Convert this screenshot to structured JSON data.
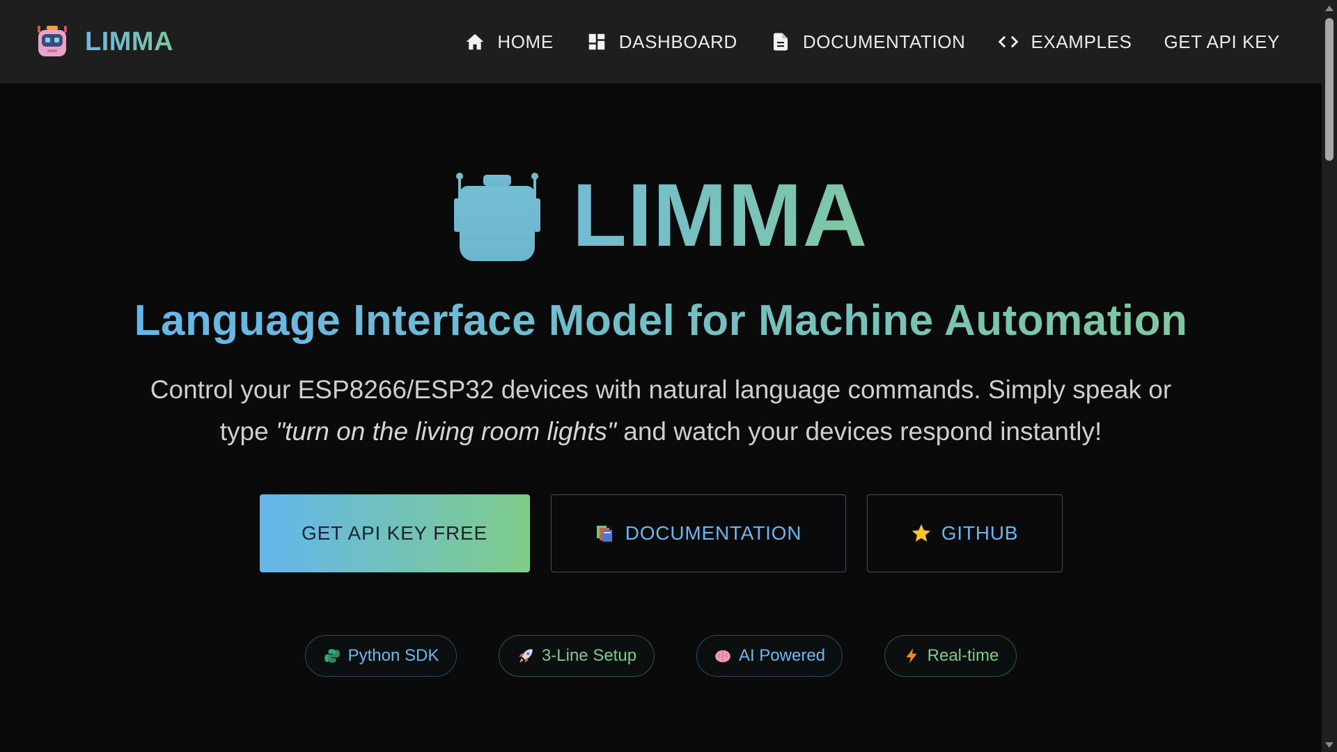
{
  "navbar": {
    "brand": "LIMMA",
    "links": [
      {
        "label": "HOME",
        "icon": "home-icon"
      },
      {
        "label": "DASHBOARD",
        "icon": "dashboard-icon"
      },
      {
        "label": "DOCUMENTATION",
        "icon": "document-icon"
      },
      {
        "label": "EXAMPLES",
        "icon": "code-icon"
      },
      {
        "label": "GET API KEY",
        "icon": ""
      }
    ]
  },
  "hero": {
    "title": "LIMMA",
    "tagline": "Language Interface Model for Machine Automation",
    "description_part1": "Control your ESP8266/ESP32 devices with natural language commands. Simply speak or type ",
    "description_quote": "\"turn on the living room lights\"",
    "description_part2": " and watch your devices respond instantly!"
  },
  "cta": {
    "primary": "GET API KEY FREE",
    "docs": "DOCUMENTATION",
    "github": "GITHUB"
  },
  "features": [
    {
      "label": "Python SDK",
      "icon": "python-icon"
    },
    {
      "label": "3-Line Setup",
      "icon": "rocket-icon"
    },
    {
      "label": "AI Powered",
      "icon": "brain-icon"
    },
    {
      "label": "Real-time",
      "icon": "lightning-icon"
    }
  ],
  "colors": {
    "background": "#0a0a0a",
    "navbar": "#1e1e1e",
    "gradient_start": "#62b7ec",
    "gradient_end": "#80cc8a",
    "link_blue": "#68b7f0",
    "accent_green": "#7dcb8b"
  }
}
